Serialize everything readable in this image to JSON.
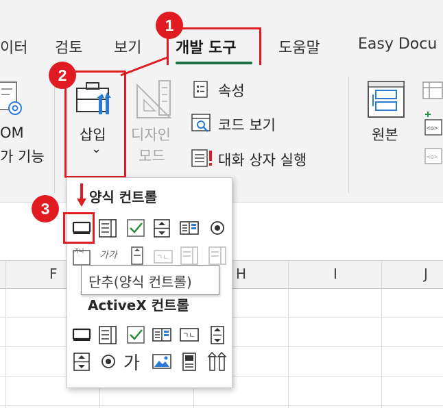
{
  "ribbon_tabs": {
    "data": "이터",
    "review": "검토",
    "view": "보기",
    "developer": "개발 도구",
    "help": "도움말",
    "easydoc": "Easy Docu"
  },
  "ribbon": {
    "addins_line1": "OM",
    "addins_line2": "가 기능",
    "insert_label": "삽입",
    "insert_chevron": "⌄",
    "design_mode_line1": "디자인",
    "design_mode_line2": "모드",
    "properties": "속성",
    "view_code": "코드 보기",
    "run_dialog": "대화 상자 실행",
    "source": "원본"
  },
  "dropdown": {
    "form_controls_heading": "양식 컨트롤",
    "activex_heading": "ActiveX 컨트롤",
    "tooltip": "단추(양식 컨트롤)",
    "form_row2_text1": "가가",
    "activex_text_label": "가"
  },
  "sheet": {
    "columns": [
      "F",
      "H",
      "I",
      "J"
    ]
  },
  "annotations": {
    "badge1": "1",
    "badge2": "2",
    "badge3": "3",
    "accent_color": "#e11b22",
    "tab_underline_color": "#1e7145"
  },
  "icons": {
    "insert": "toolbox-icon",
    "design_mode": "ruler-triangle-icon",
    "properties": "properties-icon",
    "view_code": "view-code-icon",
    "run_dialog": "run-dialog-icon",
    "source": "xml-source-icon",
    "addins": "com-addins-icon"
  }
}
